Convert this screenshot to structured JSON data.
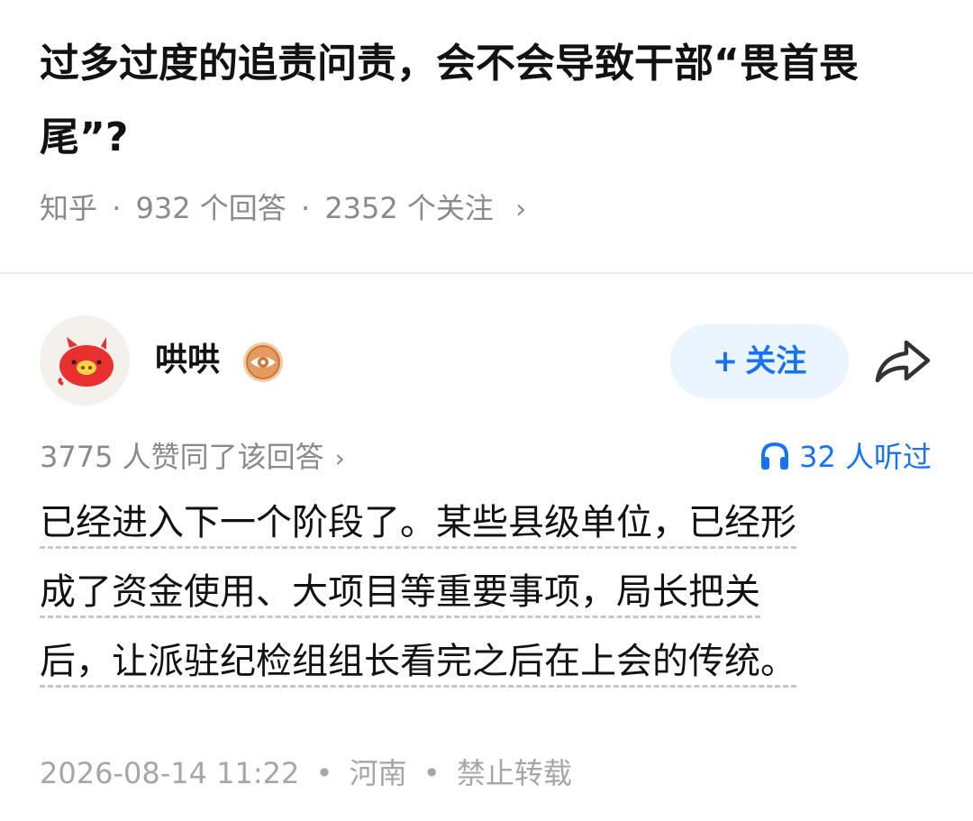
{
  "question": {
    "title": "过多过度的追责问责，会不会导致干部“畏首畏尾”?",
    "source": "知乎",
    "answers_count": "932 个回答",
    "followers_count": "2352 个关注",
    "separator": "·",
    "chevron": "›"
  },
  "author": {
    "name": "哄哄",
    "avatar_icon": "pig-avatar-icon",
    "badge_icon": "eye-badge-icon",
    "follow_label": "关注",
    "follow_plus": "+",
    "share_icon": "share-arrow-icon"
  },
  "stats": {
    "approvals": "3775 人赞同了该回答",
    "chevron": "›",
    "listeners": "32 人听过",
    "listen_icon": "headphones-icon"
  },
  "answer": {
    "lines": [
      "已经进入下一个阶段了。某些县级单位，已经形",
      "成了资金使用、大项目等重要事项，局长把关",
      "后，让派驻纪检组组长看完之后在上会的传统。"
    ]
  },
  "footer": {
    "datetime": "2026-08-14 11:22",
    "location": "河南",
    "copyright": "禁止转载",
    "separator": "•"
  },
  "colors": {
    "accent": "#1772f6",
    "follow_bg": "#ebf5ff",
    "meta_gray": "#8a8a8a",
    "footer_gray": "#a6a6a6",
    "title": "#121212"
  }
}
